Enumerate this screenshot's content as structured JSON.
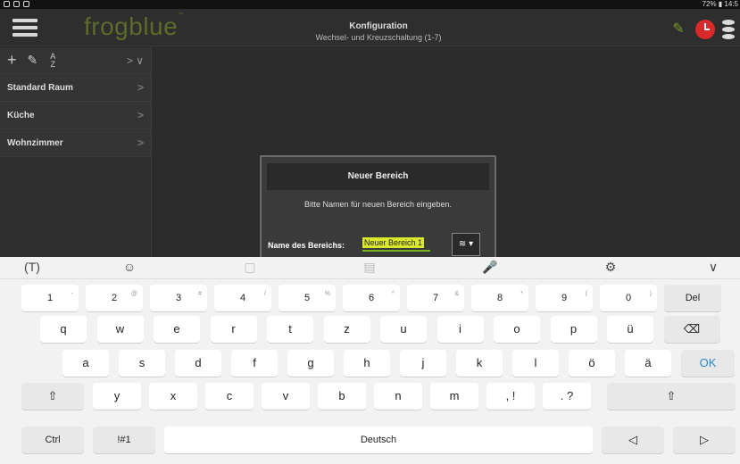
{
  "status": {
    "left_icons": [
      "notification-icon",
      "info-icon",
      "sync-icon"
    ],
    "right_text": "72% ▮ 14:5"
  },
  "header": {
    "logo_text": "frogblue",
    "title": "Konfiguration",
    "subtitle": "Wechsel- und Kreuzschaltung (1-7)"
  },
  "sidebar": {
    "toolbar": {
      "add": "+",
      "edit": "✎",
      "sort_top": "A",
      "sort_bottom": "Z",
      "expand": "> ∨"
    },
    "items": [
      {
        "label": "Standard Raum"
      },
      {
        "label": "Küche"
      },
      {
        "label": "Wohnzimmer"
      }
    ]
  },
  "dialog": {
    "title": "Neuer Bereich",
    "message": "Bitte Namen für neuen Bereich eingeben.",
    "field_label": "Name des Bereichs:",
    "field_value": "Neuer Bereich 1",
    "select_value": "≋ ▾"
  },
  "keyboard": {
    "toolbar": [
      "(T)",
      "☺",
      "▢",
      "▤",
      "🎤",
      "⚙",
      "∨"
    ],
    "row1": [
      {
        "k": "1",
        "h": "-"
      },
      {
        "k": "2",
        "h": "@"
      },
      {
        "k": "3",
        "h": "#"
      },
      {
        "k": "4",
        "h": "/"
      },
      {
        "k": "5",
        "h": "%"
      },
      {
        "k": "6",
        "h": "^"
      },
      {
        "k": "7",
        "h": "&"
      },
      {
        "k": "8",
        "h": "*"
      },
      {
        "k": "9",
        "h": "("
      },
      {
        "k": "0",
        "h": ")"
      },
      {
        "k": "Del",
        "h": ""
      }
    ],
    "row2": [
      "q",
      "w",
      "e",
      "r",
      "t",
      "z",
      "u",
      "i",
      "o",
      "p",
      "ü",
      "⌫"
    ],
    "row3": [
      "a",
      "s",
      "d",
      "f",
      "g",
      "h",
      "j",
      "k",
      "l",
      "ö",
      "ä",
      "OK"
    ],
    "row4": [
      "⇧",
      "y",
      "x",
      "c",
      "v",
      "b",
      "n",
      "m",
      ", !",
      ". ?",
      "⇧"
    ],
    "row5": [
      "Ctrl",
      "!#1",
      "Deutsch",
      "◁",
      "▷"
    ]
  }
}
